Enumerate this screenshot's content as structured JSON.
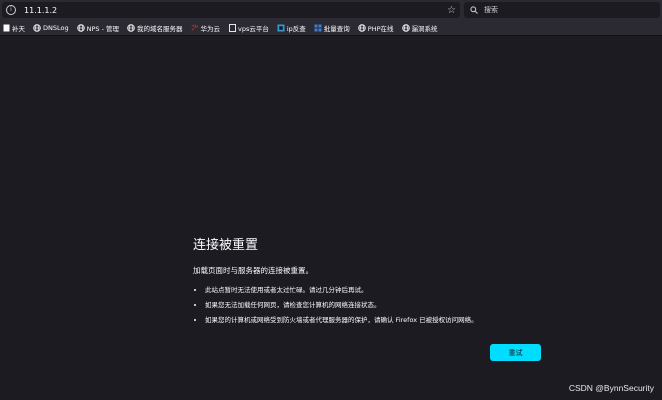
{
  "address_bar": {
    "url": "11.1.1.2",
    "info_icon": "info-icon",
    "star_icon": "bookmark-star-icon"
  },
  "search_bar": {
    "placeholder": "搜索",
    "icon": "search-icon"
  },
  "bookmarks": [
    {
      "label": "补天",
      "icon": "page-icon"
    },
    {
      "label": "DNSLog",
      "icon": "globe-icon"
    },
    {
      "label": "NPS - 管理",
      "icon": "globe-icon"
    },
    {
      "label": "我的域名服务器",
      "icon": "globe-icon"
    },
    {
      "label": "华为云",
      "icon": "huawei-icon"
    },
    {
      "label": "vps云平台",
      "icon": "page-icon"
    },
    {
      "label": "ip反查",
      "icon": "ip-icon"
    },
    {
      "label": "批量查询",
      "icon": "grid-icon"
    },
    {
      "label": "PHP在线",
      "icon": "globe-icon"
    },
    {
      "label": "漏洞系统",
      "icon": "globe-icon"
    }
  ],
  "error": {
    "title": "连接被重置",
    "description": "加载页面时与服务器的连接被重置。",
    "bullets": [
      "此站点暂时无法使用或者太过忙碌。请过几分钟后再试。",
      "如果您无法加载任何网页，请检查您计算机的网络连接状态。",
      "如果您的计算机或网络受到防火墙或者代理服务器的保护，请确认 Firefox 已被授权访问网络。"
    ],
    "retry_label": "重试"
  },
  "watermark": "CSDN @BynnSecurity",
  "colors": {
    "page_background": "#1c1b22",
    "toolbar": "#2b2a33",
    "retry_button": "#00ddff"
  }
}
